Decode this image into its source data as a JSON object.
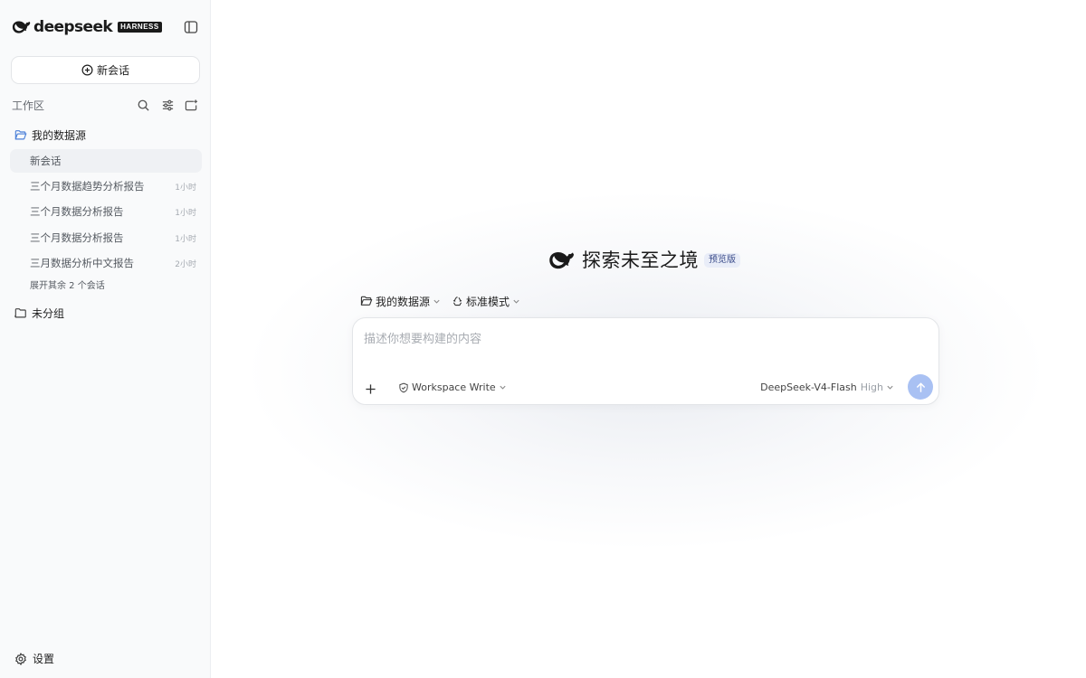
{
  "app": {
    "brand_name": "deepseek",
    "brand_badge": "HARNESS"
  },
  "sidebar": {
    "new_chat_label": "新会话",
    "workspace_label": "工作区",
    "groups": [
      {
        "label": "我的数据源",
        "icon": "folder-open-icon"
      },
      {
        "label": "未分组",
        "icon": "folder-icon"
      }
    ],
    "sessions": [
      {
        "title": "新会话",
        "time": "",
        "active": true
      },
      {
        "title": "三个月数据趋势分析报告",
        "time": "1小时"
      },
      {
        "title": "三个月数据分析报告",
        "time": "1小时"
      },
      {
        "title": "三个月数据分析报告",
        "time": "1小时"
      },
      {
        "title": "三月数据分析中文报告",
        "time": "2小时"
      }
    ],
    "expand_more": "展开其余 2 个会话",
    "settings_label": "设置"
  },
  "main": {
    "hero_title": "探索未至之境",
    "preview_badge": "预览版",
    "datasource_selector": "我的数据源",
    "mode_selector": "标准模式",
    "composer": {
      "placeholder": "描述你想要构建的内容",
      "value": "",
      "permission_label": "Workspace Write",
      "model_name": "DeepSeek-V4-Flash",
      "model_level": "High"
    }
  },
  "colors": {
    "accent_send": "#a9c1f3",
    "folder_blue": "#4a7fd8",
    "preview_badge_bg": "#e9edf8",
    "preview_badge_text": "#3b4c8a"
  }
}
